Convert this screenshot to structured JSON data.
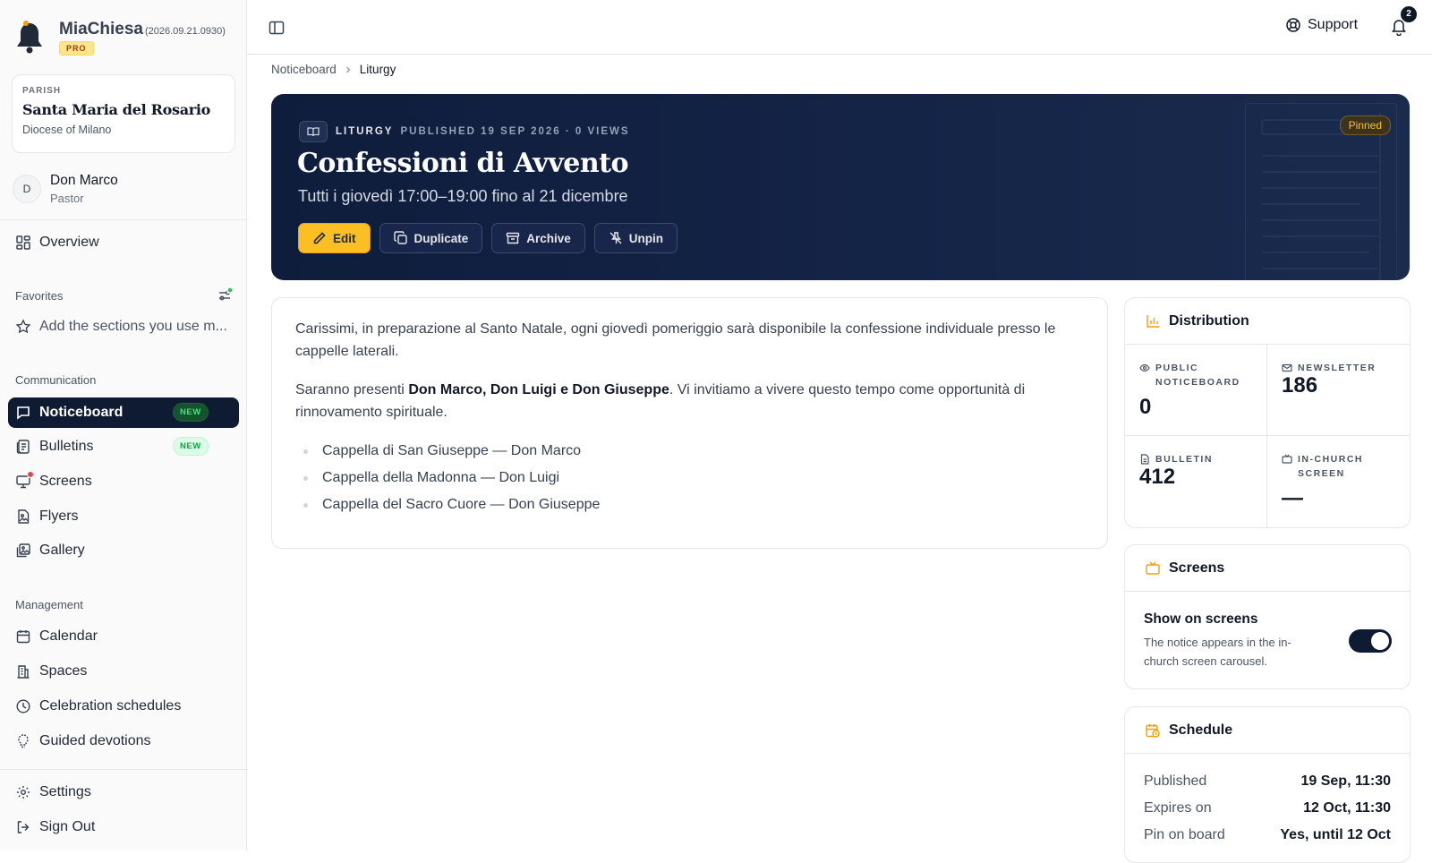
{
  "app": {
    "name": "MiaChiesa",
    "version": "(2026.09.21.0930)",
    "plan": "PRO"
  },
  "parish": {
    "label": "PARISH",
    "name": "Santa Maria del Rosario",
    "diocese": "Diocese of Milano"
  },
  "user": {
    "initial": "D",
    "name": "Don Marco",
    "role": "Pastor"
  },
  "nav": {
    "overview": "Overview",
    "favorites_title": "Favorites",
    "favorites_hint": "Add the sections you use m...",
    "communication_title": "Communication",
    "noticeboard": "Noticeboard",
    "bulletins": "Bulletins",
    "screens": "Screens",
    "flyers": "Flyers",
    "gallery": "Gallery",
    "new_badge": "NEW",
    "management_title": "Management",
    "calendar": "Calendar",
    "spaces": "Spaces",
    "celebration_schedules": "Celebration schedules",
    "guided_devotions": "Guided devotions",
    "settings": "Settings",
    "sign_out": "Sign Out"
  },
  "topbar": {
    "support": "Support",
    "notifications_count": "2"
  },
  "breadcrumb": {
    "parent": "Noticeboard",
    "current": "Liturgy"
  },
  "notice": {
    "category": "LITURGY",
    "meta": "PUBLISHED 19 SEP 2026 · 0 VIEWS",
    "title": "Confessioni di Avvento",
    "subtitle": "Tutti i giovedì 17:00–19:00 fino al 21 dicembre",
    "pinned": "Pinned",
    "actions": {
      "edit": "Edit",
      "duplicate": "Duplicate",
      "archive": "Archive",
      "unpin": "Unpin"
    },
    "body": {
      "p1": "Carissimi, in preparazione al Santo Natale, ogni giovedì pomeriggio sarà disponibile la confessione individuale presso le cappelle laterali.",
      "p2_before": "Saranno presenti ",
      "p2_bold": "Don Marco, Don Luigi e Don Giuseppe",
      "p2_after": ". Vi invitiamo a vivere questo tempo come opportunità di rinnovamento spirituale.",
      "list": [
        "Cappella di San Giuseppe — Don Marco",
        "Cappella della Madonna — Don Luigi",
        "Cappella del Sacro Cuore — Don Giuseppe"
      ]
    }
  },
  "distribution": {
    "title": "Distribution",
    "public": {
      "label": "PUBLIC NOTICEBOARD",
      "value": "0"
    },
    "newsletter": {
      "label": "NEWSLETTER",
      "value": "186"
    },
    "bulletin": {
      "label": "BULLETIN",
      "value": "412"
    },
    "screen": {
      "label": "IN-CHURCH SCREEN",
      "value": "—"
    }
  },
  "screens_card": {
    "title": "Screens",
    "toggle_label": "Show on screens",
    "toggle_desc": "The notice appears in the in-church screen carousel.",
    "toggle_on": true
  },
  "schedule": {
    "title": "Schedule",
    "rows": [
      {
        "k": "Published",
        "v": "19 Sep, 11:30"
      },
      {
        "k": "Expires on",
        "v": "12 Oct, 11:30"
      },
      {
        "k": "Pin on board",
        "v": "Yes, until 12 Oct"
      }
    ]
  }
}
